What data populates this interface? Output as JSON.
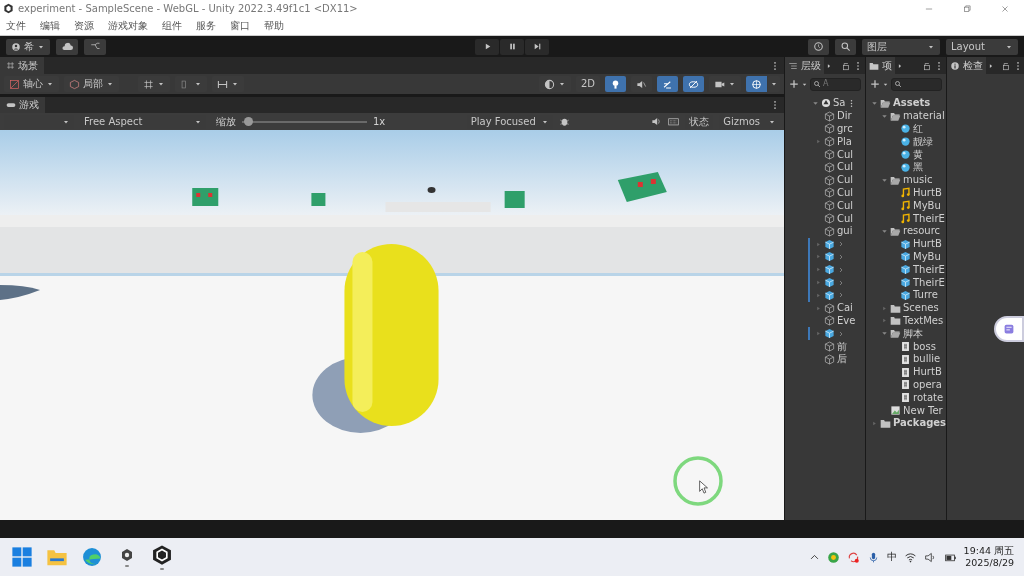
{
  "window": {
    "title": "experiment - SampleScene - WebGL - Unity 2022.3.49f1c1 <DX11>"
  },
  "menu": [
    "文件",
    "编辑",
    "资源",
    "游戏对象",
    "组件",
    "服务",
    "窗口",
    "帮助"
  ],
  "toolbar": {
    "account": "希",
    "layers": "图层",
    "layout": "Layout"
  },
  "scene_panel": {
    "tab": "场景",
    "pivot": "轴心",
    "space": "局部",
    "mode_2d": "2D",
    "toggles": [
      {
        "kind": "shading",
        "on": false
      },
      {
        "kind": "lighting",
        "on": true
      },
      {
        "kind": "audio",
        "on": false
      },
      {
        "kind": "effects",
        "on": true
      },
      {
        "kind": "visibility",
        "on": true
      },
      {
        "kind": "camera",
        "on": false
      },
      {
        "kind": "gizmos",
        "on": true
      }
    ]
  },
  "game_panel": {
    "tab": "游戏",
    "aspect": "Free Aspect",
    "scale_label": "缩放",
    "scale": {
      "level": 0.02
    },
    "scale_reading": "1x",
    "play_mode": "Play Focused",
    "stats": "状态",
    "gizmos": "Gizmos"
  },
  "hierarchy": {
    "title": "层级",
    "search_placeholder": "A",
    "scene": {
      "name": "Sa",
      "expanded": true,
      "children": [
        {
          "name": "Dir",
          "kind": "object",
          "expandable": false
        },
        {
          "name": "grc",
          "kind": "object",
          "expandable": false
        },
        {
          "name": "Pla",
          "kind": "object",
          "expandable": true
        },
        {
          "name": "Cul",
          "kind": "object",
          "expandable": false
        },
        {
          "name": "Cul",
          "kind": "object",
          "expandable": false
        },
        {
          "name": "Cul",
          "kind": "object",
          "expandable": false
        },
        {
          "name": "Cul",
          "kind": "object",
          "expandable": false
        },
        {
          "name": "Cul",
          "kind": "object",
          "expandable": false
        },
        {
          "name": "Cul",
          "kind": "object",
          "expandable": false
        },
        {
          "name": "gui",
          "kind": "object",
          "expandable": false
        },
        {
          "kind": "prefab",
          "expandable": true
        },
        {
          "kind": "prefab",
          "expandable": true
        },
        {
          "kind": "prefab",
          "expandable": true
        },
        {
          "kind": "prefab",
          "expandable": true
        },
        {
          "kind": "prefab",
          "expandable": true
        },
        {
          "name": "Cai",
          "kind": "object",
          "expandable": true
        },
        {
          "name": "Eve",
          "kind": "object",
          "expandable": false
        },
        {
          "kind": "prefab",
          "expandable": true
        },
        {
          "name": "前",
          "kind": "object",
          "expandable": false
        },
        {
          "name": "后",
          "kind": "object",
          "expandable": false
        }
      ]
    }
  },
  "project": {
    "title": "项",
    "tree": [
      {
        "name": "Assets",
        "kind": "folder",
        "expanded": true,
        "children": [
          {
            "name": "material",
            "kind": "folder",
            "expanded": true,
            "children": [
              {
                "name": "红",
                "kind": "material"
              },
              {
                "name": "靓绿",
                "kind": "material"
              },
              {
                "name": "黄",
                "kind": "material"
              },
              {
                "name": "黑",
                "kind": "material"
              }
            ]
          },
          {
            "name": "music",
            "kind": "folder",
            "expanded": true,
            "children": [
              {
                "name": "HurtB",
                "kind": "audio"
              },
              {
                "name": "MyBu",
                "kind": "audio"
              },
              {
                "name": "TheirE",
                "kind": "audio"
              }
            ]
          },
          {
            "name": "resourc",
            "kind": "folder",
            "expanded": true,
            "children": [
              {
                "name": "HurtB",
                "kind": "prefab"
              },
              {
                "name": "MyBu",
                "kind": "prefab"
              },
              {
                "name": "TheirE",
                "kind": "prefab"
              },
              {
                "name": "TheirE",
                "kind": "prefab"
              },
              {
                "name": "Turre",
                "kind": "prefab"
              }
            ]
          },
          {
            "name": "Scenes",
            "kind": "folder",
            "expanded": false
          },
          {
            "name": "TextMes",
            "kind": "folder",
            "expanded": false
          },
          {
            "name": "脚本",
            "kind": "folder",
            "expanded": true,
            "children": [
              {
                "name": "boss",
                "kind": "script"
              },
              {
                "name": "bullie",
                "kind": "script"
              },
              {
                "name": "HurtB",
                "kind": "script"
              },
              {
                "name": "opera",
                "kind": "script"
              },
              {
                "name": "rotate",
                "kind": "script"
              }
            ]
          },
          {
            "name": "New Ter",
            "kind": "texture"
          }
        ]
      },
      {
        "name": "Packages",
        "kind": "folder",
        "expanded": false
      }
    ]
  },
  "inspector": {
    "title": "检查"
  },
  "taskbar": {
    "apps": [
      {
        "kind": "start",
        "running": false
      },
      {
        "kind": "explorer",
        "running": false
      },
      {
        "kind": "edge",
        "running": false
      },
      {
        "kind": "hub",
        "running": true
      },
      {
        "kind": "unity",
        "running": true
      }
    ],
    "ime": "中",
    "time": "19:44 周五",
    "date": "2025/8/29"
  }
}
